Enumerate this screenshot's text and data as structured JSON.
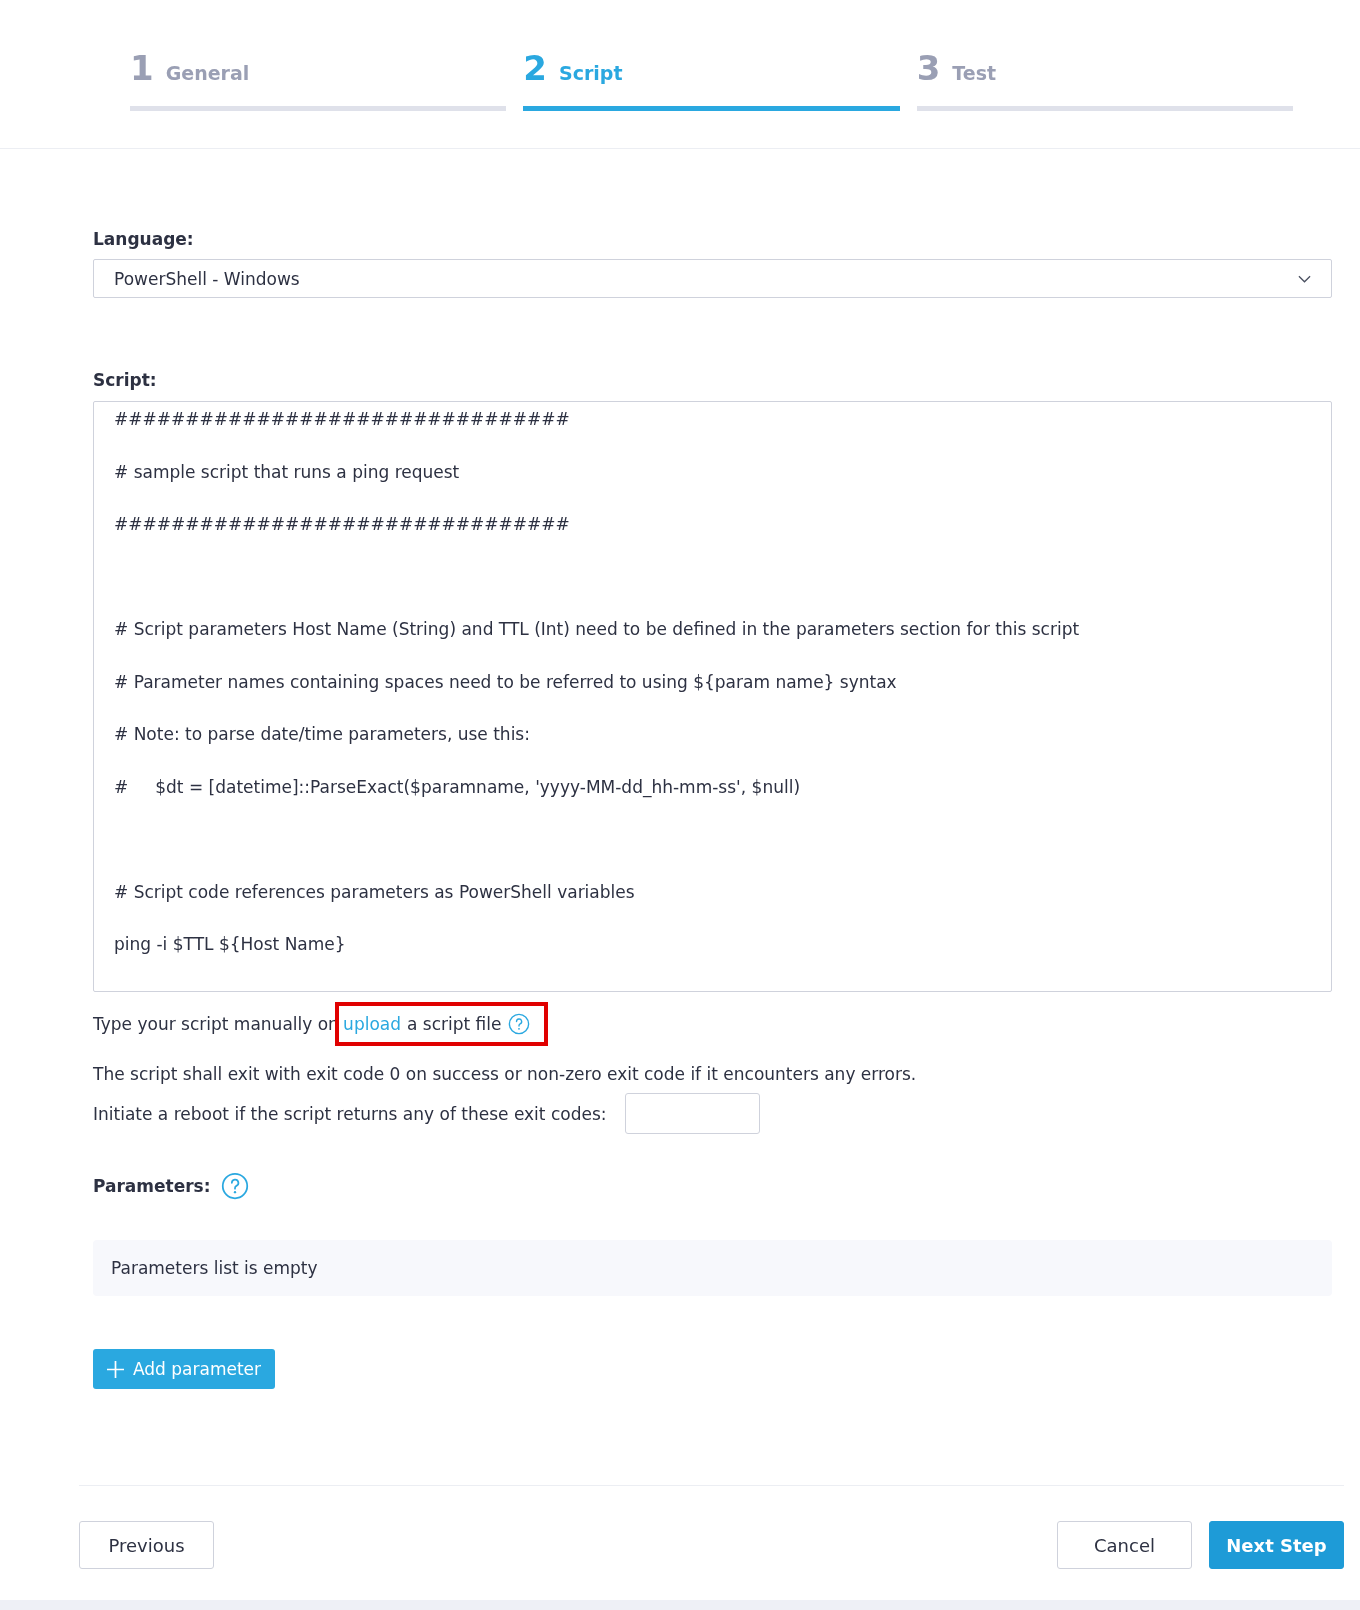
{
  "steps": [
    {
      "number": "1",
      "label": "General",
      "selected": false
    },
    {
      "number": "2",
      "label": "Script",
      "selected": true
    },
    {
      "number": "3",
      "label": "Test",
      "selected": false
    }
  ],
  "language": {
    "label": "Language:",
    "value": "PowerShell - Windows"
  },
  "script": {
    "label": "Script:",
    "blocks": [
      [
        "################################",
        "# sample script that runs a ping request",
        "################################"
      ],
      [
        "# Script parameters Host Name (String) and TTL (Int) need to be defined in the parameters section for this script",
        "# Parameter names containing spaces need to be referred to using ${param name} syntax",
        "# Note: to parse date/time parameters, use this:",
        "#     $dt = [datetime]::ParseExact($paramname, 'yyyy-MM-dd_hh-mm-ss', $null)"
      ],
      [
        "# Script code references parameters as PowerShell variables",
        "ping -i $TTL ${Host Name}"
      ]
    ]
  },
  "upload_hint": {
    "before": "Type your script manually or",
    "link": "upload",
    "after": "a script file",
    "highlighted": true
  },
  "exit_note": "The script shall exit with exit code 0 on success or non-zero exit code if it encounters any errors.",
  "reboot_label": "Initiate a reboot if the script returns any of these exit codes:",
  "parameters": {
    "label": "Parameters:",
    "empty_text": "Parameters list is empty",
    "add_button": "Add parameter"
  },
  "footer": {
    "previous": "Previous",
    "cancel": "Cancel",
    "next": "Next Step"
  }
}
